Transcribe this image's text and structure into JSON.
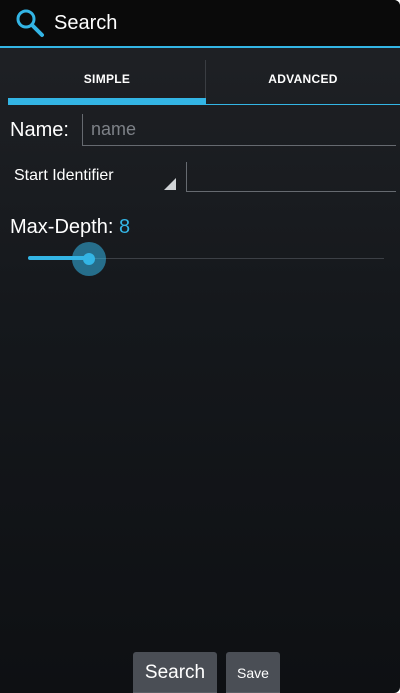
{
  "action_bar": {
    "title": "Search",
    "icon": "search-icon"
  },
  "tabs": [
    {
      "label": "SIMPLE",
      "selected": true
    },
    {
      "label": "ADVANCED",
      "selected": false
    }
  ],
  "form": {
    "name_label": "Name:",
    "name_placeholder": "name",
    "name_value": "",
    "start_spinner_value": "Start Identifier",
    "identifier_value": "",
    "maxdepth_label": "Max-Depth:",
    "maxdepth_value": "8",
    "maxdepth_fraction": 0.17
  },
  "buttons": {
    "search_label": "Search",
    "save_label": "Save"
  },
  "colors": {
    "accent": "#33b5e5",
    "action_bar_bg": "#0a0a0a",
    "screen_bg": "#16191d",
    "button_bg": "#4a4e55"
  }
}
